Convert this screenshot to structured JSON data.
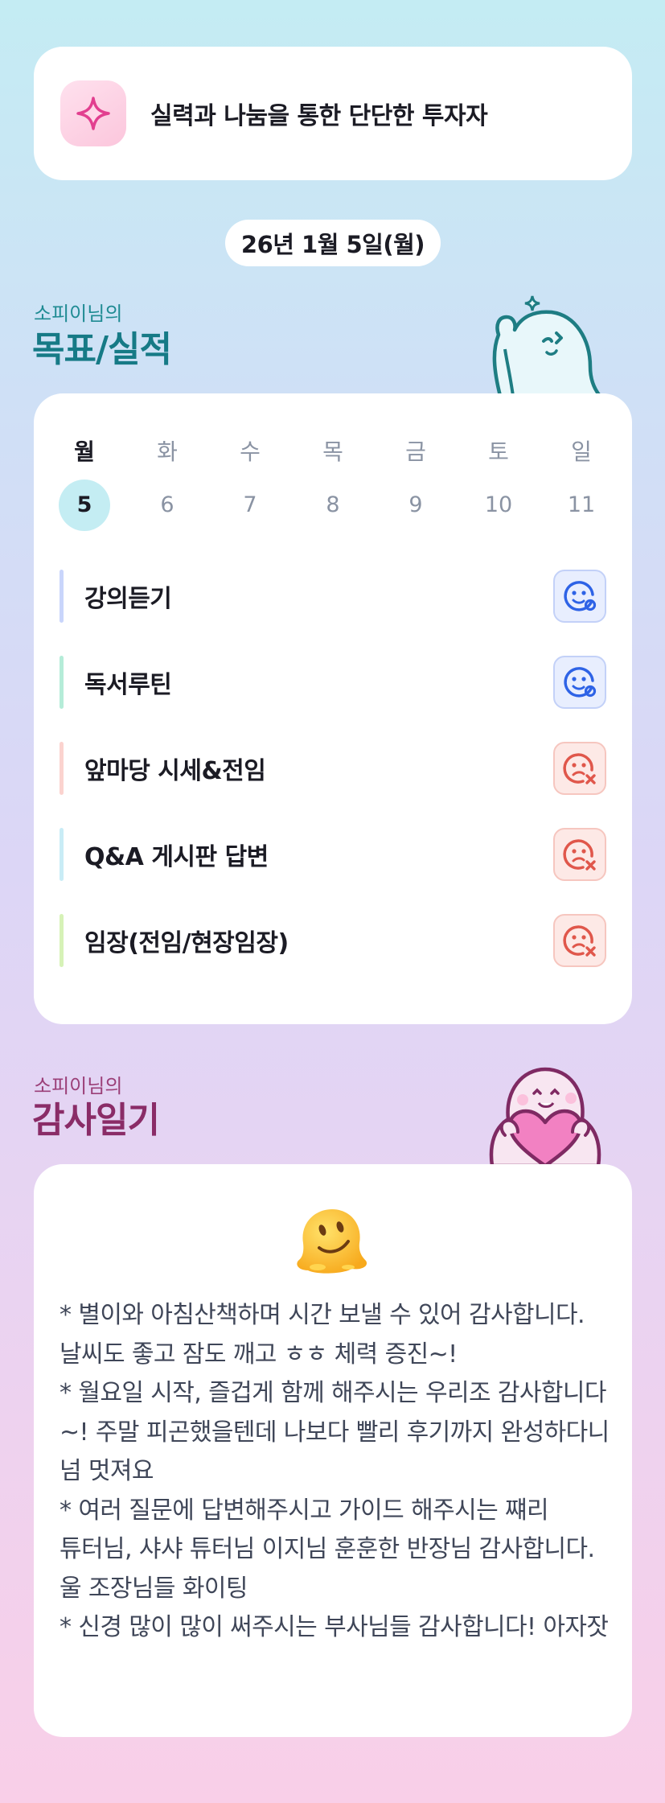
{
  "motto": {
    "text": "실력과 나눔을 통한 단단한 투자자",
    "icon": "sparkle-icon"
  },
  "date": "26년 1월 5일(월)",
  "goals_section": {
    "subtitle": "소피이님의",
    "title": "목표/실적"
  },
  "week": {
    "days": [
      "월",
      "화",
      "수",
      "목",
      "금",
      "토",
      "일"
    ],
    "dates": [
      "5",
      "6",
      "7",
      "8",
      "9",
      "10",
      "11"
    ],
    "selected_index": 0
  },
  "goals": [
    {
      "label": "강의듣기",
      "status": "done",
      "color": "#c9d5fb"
    },
    {
      "label": "독서루틴",
      "status": "done",
      "color": "#b5ecd8"
    },
    {
      "label": "앞마당 시세&전임",
      "status": "miss",
      "color": "#fbd3cf"
    },
    {
      "label": "Q&A 게시판 답변",
      "status": "miss",
      "color": "#c9ecf6"
    },
    {
      "label": "임장(전임/현장임장)",
      "status": "miss",
      "color": "#d6f2b7"
    }
  ],
  "colors": {
    "done": "#2e63e6",
    "miss": "#e0574b",
    "teal": "#167a86",
    "plum": "#8a2c67"
  },
  "thanks_section": {
    "subtitle": "소피이님의",
    "title": "감사일기"
  },
  "diary": {
    "emoji": "melting-face",
    "text": "* 별이와 아침산책하며 시간 보낼 수 있어 감사합니다. 날씨도 좋고 잠도 깨고 ㅎㅎ 체력 증진~!\n* 월요일 시작, 즐겁게 함께 해주시는 우리조 감사합니다~! 주말 피곤했을텐데 나보다 빨리 후기까지 완성하다니 넘 멋져요\n* 여러 질문에 답변해주시고 가이드 해주시는 쨰리 튜터님, 샤샤 튜터님 이지님 훈훈한 반장님 감사합니다. 울 조장님들 화이팅\n* 신경 많이 많이 써주시는 부사님들 감사합니다! 아자잣"
  }
}
